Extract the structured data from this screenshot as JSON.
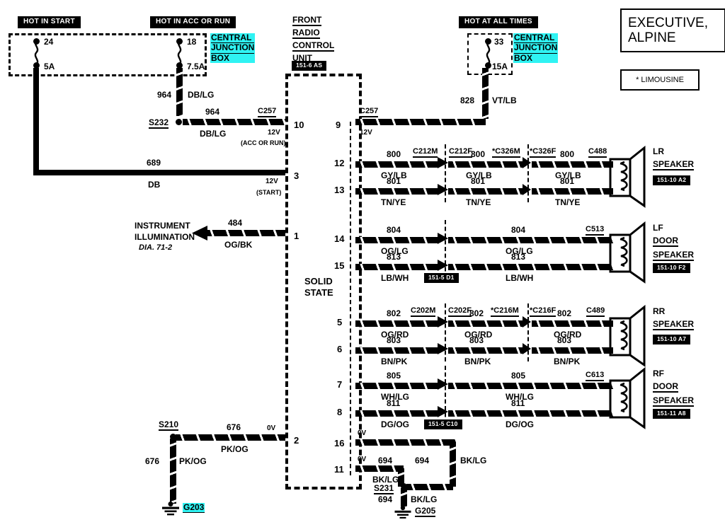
{
  "title_boxes": {
    "main": "EXECUTIVE,\nALPINE",
    "main_line1": "EXECUTIVE,",
    "main_line2": "ALPINE",
    "footnote": "*  LIMOUSINE"
  },
  "power_sources": [
    {
      "name": "hot-in-start",
      "label": "HOT IN START",
      "fuse_cavity": "24",
      "fuse_rating": "5A"
    },
    {
      "name": "hot-in-acc-or-run",
      "label": "HOT IN ACC OR RUN",
      "fuse_cavity": "18",
      "fuse_rating": "7.5A"
    },
    {
      "name": "hot-at-all-times",
      "label": "HOT AT ALL TIMES",
      "fuse_cavity": "33",
      "fuse_rating": "15A"
    }
  ],
  "junction_boxes": [
    {
      "name": "cjb-left",
      "line1": "CENTRAL",
      "line2": "JUNCTION",
      "line3": "BOX"
    },
    {
      "name": "cjb-right",
      "line1": "CENTRAL",
      "line2": "JUNCTION",
      "line3": "BOX"
    }
  ],
  "module": {
    "title_line1": "FRONT",
    "title_line2": "RADIO",
    "title_line3": "CONTROL",
    "title_line4": "UNIT",
    "ref": "151-6 AS",
    "note_line1": "SOLID",
    "note_line2": "STATE"
  },
  "feeds": [
    {
      "name": "feed-964",
      "circuit": "964",
      "color": "DB/LG",
      "splice": "S232",
      "connector": "C257",
      "volt": "12V",
      "state": "(ACC OR RUN)",
      "pin": "10"
    },
    {
      "name": "feed-689",
      "circuit": "689",
      "color": "DB",
      "connector": "",
      "volt": "12V",
      "state": "(START)",
      "pin": "3"
    },
    {
      "name": "feed-828",
      "circuit": "828",
      "color": "VT/LB",
      "connector": "C257",
      "volt": "12V",
      "pin": "9"
    }
  ],
  "illumination": {
    "label_line1": "INSTRUMENT",
    "label_line2": "ILLUMINATION",
    "diagram_ref": "DIA. 71-2",
    "circuit": "484",
    "color": "OG/BK",
    "pin": "1"
  },
  "speaker_groups": [
    {
      "name": "lr-speaker",
      "speaker_line1": "LR",
      "speaker_line2": "SPEAKER",
      "speaker_line3": "",
      "ref": "151-10 A2",
      "final_connector": "C488",
      "mid_connectors": [
        "C212M",
        "C212F",
        "*C326M",
        "*C326F"
      ],
      "wires": [
        {
          "pin": "12",
          "circuit": "800",
          "color": "GY/LB",
          "segments": 3
        },
        {
          "pin": "13",
          "circuit": "801",
          "color": "TN/YE",
          "segments": 3
        }
      ]
    },
    {
      "name": "lf-door-speaker",
      "speaker_line1": "LF",
      "speaker_line2": "DOOR",
      "speaker_line3": "SPEAKER",
      "ref": "151-10 F2",
      "final_connector": "C513",
      "mid_connectors": [],
      "inline_ref": "151-5 D1",
      "wires": [
        {
          "pin": "14",
          "circuit": "804",
          "color": "OG/LG",
          "segments": 2
        },
        {
          "pin": "15",
          "circuit": "813",
          "color": "LB/WH",
          "segments": 2
        }
      ]
    },
    {
      "name": "rr-speaker",
      "speaker_line1": "RR",
      "speaker_line2": "SPEAKER",
      "speaker_line3": "",
      "ref": "151-10 A7",
      "final_connector": "C489",
      "mid_connectors": [
        "C202M",
        "C202F",
        "*C216M",
        "*C216F"
      ],
      "wires": [
        {
          "pin": "5",
          "circuit": "802",
          "color": "OG/RD",
          "segments": 3
        },
        {
          "pin": "6",
          "circuit": "803",
          "color": "BN/PK",
          "segments": 3
        }
      ]
    },
    {
      "name": "rf-door-speaker",
      "speaker_line1": "RF",
      "speaker_line2": "DOOR",
      "speaker_line3": "SPEAKER",
      "ref": "151-11 A8",
      "final_connector": "C613",
      "mid_connectors": [],
      "inline_ref": "151-5 C10",
      "wires": [
        {
          "pin": "7",
          "circuit": "805",
          "color": "WH/LG",
          "segments": 2
        },
        {
          "pin": "8",
          "circuit": "811",
          "color": "DG/OG",
          "segments": 2
        }
      ]
    }
  ],
  "grounds": [
    {
      "name": "ground-g203",
      "splice": "S210",
      "circuit_h": "676",
      "color_h": "PK/OG",
      "circuit_v": "676",
      "color_v": "PK/OG",
      "ground_label": "G203",
      "pin": "2",
      "volt": "0V"
    },
    {
      "name": "ground-g205",
      "splice": "S231",
      "circuit_top": "694",
      "circuit_mid": "694",
      "circuit_bottom": "694",
      "color": "BK/LG",
      "ground_label": "G205",
      "pin_top": "16",
      "pin_bottom": "11",
      "volt_top": "0V",
      "volt_bottom": "0V"
    }
  ],
  "colors": {
    "highlight": "#2ff3f3",
    "line": "#000000",
    "background": "#ffffff"
  }
}
